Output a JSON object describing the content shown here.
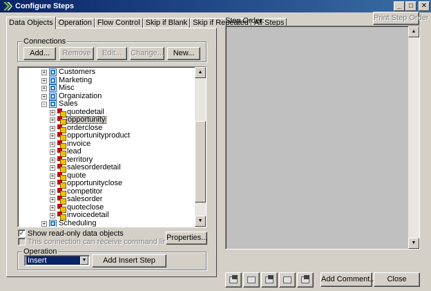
{
  "window": {
    "title": "Configure Steps",
    "buttons": [
      "_",
      "□",
      "✕"
    ]
  },
  "tabs": [
    {
      "label": "Data Objects",
      "active": true
    },
    {
      "label": "Operation"
    },
    {
      "label": "Flow Control"
    },
    {
      "label": "Skip if Blank"
    },
    {
      "label": "Skip if Repeated"
    },
    {
      "label": "All Steps"
    }
  ],
  "connections": {
    "legend": "Connections",
    "add_label": "Add...",
    "remove_label": "Remove",
    "edit_label": "Edit...",
    "change_label": "Change...",
    "new_label": "New..."
  },
  "tree": {
    "items": [
      {
        "label": "Customers",
        "level": 0,
        "type": "folder",
        "expanded": false
      },
      {
        "label": "Marketing",
        "level": 0,
        "type": "folder",
        "expanded": false
      },
      {
        "label": "Misc",
        "level": 0,
        "type": "folder",
        "expanded": false
      },
      {
        "label": "Organization",
        "level": 0,
        "type": "folder",
        "expanded": false
      },
      {
        "label": "Sales",
        "level": 0,
        "type": "folder",
        "expanded": true
      },
      {
        "label": "quotedetail",
        "level": 1,
        "type": "entity"
      },
      {
        "label": "opportunity",
        "level": 1,
        "type": "entity",
        "selected": true
      },
      {
        "label": "orderclose",
        "level": 1,
        "type": "entity"
      },
      {
        "label": "opportunityproduct",
        "level": 1,
        "type": "entity"
      },
      {
        "label": "invoice",
        "level": 1,
        "type": "entity"
      },
      {
        "label": "lead",
        "level": 1,
        "type": "entity"
      },
      {
        "label": "territory",
        "level": 1,
        "type": "entity"
      },
      {
        "label": "salesorderdetail",
        "level": 1,
        "type": "entity"
      },
      {
        "label": "quote",
        "level": 1,
        "type": "entity"
      },
      {
        "label": "opportunityclose",
        "level": 1,
        "type": "entity"
      },
      {
        "label": "competitor",
        "level": 1,
        "type": "entity"
      },
      {
        "label": "salesorder",
        "level": 1,
        "type": "entity"
      },
      {
        "label": "quoteclose",
        "level": 1,
        "type": "entity"
      },
      {
        "label": "invoicedetail",
        "level": 1,
        "type": "entity"
      },
      {
        "label": "Scheduling",
        "level": 0,
        "type": "folder",
        "expanded": false
      }
    ]
  },
  "options": {
    "show_readonly_label": "Show read-only data objects",
    "show_readonly_checked": true,
    "cmdline_label": "This connection can receive command line switches.",
    "cmdline_checked": false,
    "properties_label": "Properties..."
  },
  "operation": {
    "legend": "Operation",
    "selected": "Insert",
    "add_step_label": "Add Insert Step"
  },
  "step_order": {
    "label": "Step Order:",
    "print_label": "Print Step Order"
  },
  "footer": {
    "toolbar_icons": [
      "insert-step-icon",
      "copy-step-icon",
      "move-step-icon",
      "link-step-icon",
      "delete-step-icon"
    ],
    "add_comment_label": "Add Comment...",
    "close_label": "Close"
  }
}
